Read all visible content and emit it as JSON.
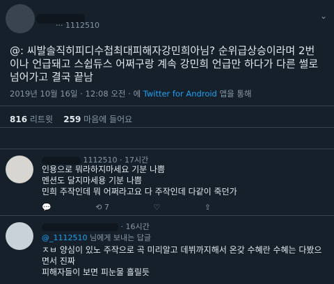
{
  "tweet": {
    "text": "@: 씨발솔직히피디수첩최대피해자강민희아님? 순위급상승이라며 2번이나 언급돼고 스쉽듀스 어쩌구랑 계속 강민희 언급만 하다가 다른 썰로 넘어가고 결국 끝남",
    "date": "2019년 10월 16일 · 12:08 오전 · 에",
    "source": "Twitter for Android",
    "source_suffix": "앱을 통해",
    "retweets": "816",
    "retweets_label": "리트윗",
    "likes": "259",
    "likes_label": "마음에 들어요"
  },
  "header": {
    "handle_fragment": "··· 1112510"
  },
  "replies": [
    {
      "handle": "1112510 · 17시간",
      "text_lines": [
        "인용으로 뭐라하지마세요 기분 나쁨",
        "멘션도 달지마세용 기분 나쁨",
        "민희 주작인데 뭐 어쩌라고요 다 주작인데 다같이 죽던가"
      ],
      "retweet_count": "7"
    },
    {
      "handle": "· 16시간",
      "replying_to_handle": "@_1112510",
      "replying_to_suffix": "님에게 보내는 답글",
      "text_lines": [
        "ㅈㅂ 양심이 있노 주작으로 곡 미리알고 데뷔까지해서 온갖 수혜란 수혜는 다봤으면서 진짜",
        "피해자들이 보면 피눈물 흘릴듯"
      ]
    }
  ]
}
